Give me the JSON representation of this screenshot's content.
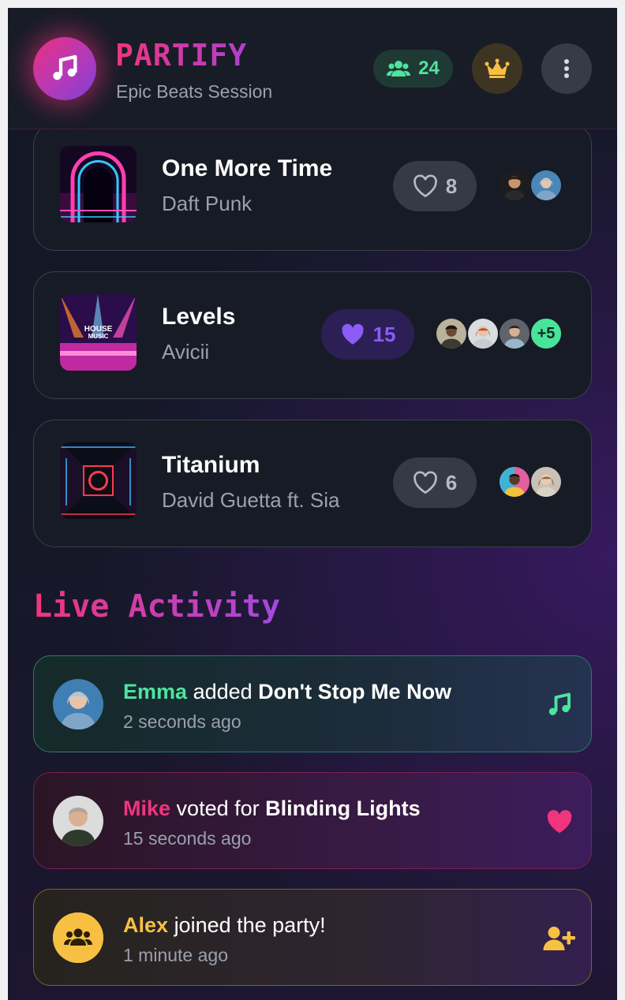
{
  "header": {
    "app_name": "PARTIFY",
    "session_name": "Epic Beats Session",
    "guest_count": "24",
    "icons": {
      "logo": "music-note-icon",
      "guests": "users-icon",
      "host": "crown-icon",
      "menu": "more-vertical-icon"
    }
  },
  "queue": [
    {
      "title": "One More Time",
      "artist": "Daft Punk",
      "votes": "8",
      "voted": false,
      "voter_avatars": 2,
      "more_voters": ""
    },
    {
      "title": "Levels",
      "artist": "Avicii",
      "votes": "15",
      "voted": true,
      "voter_avatars": 3,
      "more_voters": "+5"
    },
    {
      "title": "Titanium",
      "artist": "David Guetta ft. Sia",
      "votes": "6",
      "voted": false,
      "voter_avatars": 2,
      "more_voters": ""
    }
  ],
  "activity": {
    "title": "Live Activity",
    "items": [
      {
        "user": "Emma",
        "action": "added",
        "target": "Don't Stop Me Now",
        "time": "2 seconds ago",
        "icon": "music-note-icon"
      },
      {
        "user": "Mike",
        "action": "voted for",
        "target": "Blinding Lights",
        "time": "15 seconds ago",
        "icon": "heart-icon"
      },
      {
        "user": "Alex",
        "action": "joined the party!",
        "target": "",
        "time": "1 minute ago",
        "icon": "user-plus-icon"
      }
    ]
  },
  "colors": {
    "accent_pink": "#f0357c",
    "accent_purple": "#8b5cf6",
    "accent_green": "#4fe3a0",
    "accent_yellow": "#f7c043",
    "background": "#141826"
  }
}
